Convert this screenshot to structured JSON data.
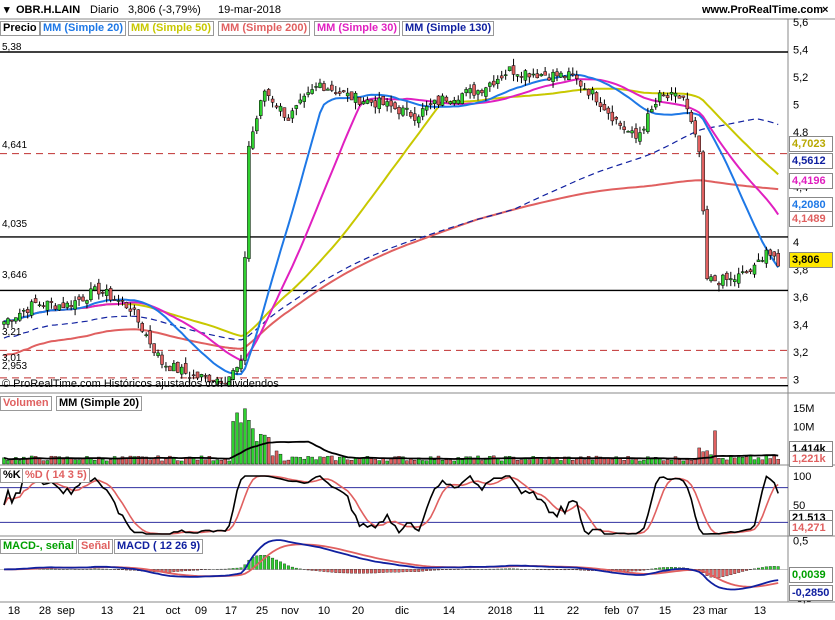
{
  "header": {
    "symbol": "OBR.H.LAIN",
    "period": "Diario",
    "quote": "3,806 (-3,79%)",
    "date": "19-mar-2018",
    "site": "www.ProRealTime.com"
  },
  "price_panel": {
    "label": "Precio",
    "legend": [
      {
        "label": "MM (Simple 20)",
        "color": "#1e78e6"
      },
      {
        "label": "MM (Simple 50)",
        "color": "#c8c800"
      },
      {
        "label": "MM (Simple 200)",
        "color": "#e06060"
      },
      {
        "label": "MM (Simple 30)",
        "color": "#e020c0"
      },
      {
        "label": "MM (Simple 130)",
        "color": "#1020a0"
      }
    ],
    "copyright": "© ProRealTime.com  Históricos ajustados con dividendos",
    "level_labels": [
      "5,38",
      "4,641",
      "4,035",
      "3,646",
      "3,21",
      "3,01",
      "2,953"
    ],
    "tags": [
      {
        "text": "4,7023",
        "color": "#b8a800"
      },
      {
        "text": "4,5612",
        "color": "#1020a0"
      },
      {
        "text": "4,4196",
        "color": "#e020c0"
      },
      {
        "text": "4,2080",
        "color": "#1e78e6"
      },
      {
        "text": "4,1489",
        "color": "#e06060"
      },
      {
        "text": "3,806",
        "color": "#000000"
      }
    ]
  },
  "volume_panel": {
    "label": "Volumen",
    "ma_label": "MM (Simple 20)",
    "tags": [
      {
        "text": "1,414k",
        "color": "#000000"
      },
      {
        "text": "1,221k",
        "color": "#e06060"
      }
    ]
  },
  "stoch_panel": {
    "label_k": "%K",
    "label_d": "%D ( 14 3 5)",
    "tags": [
      {
        "text": "21,513",
        "color": "#000000"
      },
      {
        "text": "14,271",
        "color": "#e06060"
      }
    ]
  },
  "macd_panel": {
    "label_macd": "MACD-, señal",
    "label_signal": "Señal",
    "label_params": "MACD ( 12 26 9)",
    "tags": [
      {
        "text": "0,0039",
        "color": "#00a000"
      },
      {
        "text": "-0,2850",
        "color": "#1020a0"
      }
    ]
  },
  "chart_data": {
    "type": "candlestick",
    "colors": {
      "up": "#30d030",
      "down": "#e06060"
    },
    "price_axis": {
      "min": 2.9,
      "max": 5.62,
      "ticks": [
        "5,6",
        "5,4",
        "5,2",
        "5",
        "4,8",
        "4,6",
        "4,4",
        "4,2",
        "4",
        "3,8",
        "3,6",
        "3,4",
        "3,2",
        "3"
      ],
      "tick_values": [
        5.6,
        5.4,
        5.2,
        5.0,
        4.8,
        4.6,
        4.4,
        4.2,
        4.0,
        3.8,
        3.6,
        3.4,
        3.2,
        3.0
      ]
    },
    "horizontal_levels": [
      {
        "value": 5.38,
        "style": "solid"
      },
      {
        "value": 4.641,
        "style": "dashed"
      },
      {
        "value": 4.035,
        "style": "solid"
      },
      {
        "value": 3.646,
        "style": "solid"
      },
      {
        "value": 3.21,
        "style": "dashed"
      },
      {
        "value": 3.01,
        "style": "dashed"
      },
      {
        "value": 2.953,
        "style": "solid"
      }
    ],
    "x_labels": [
      "18",
      "28",
      "sep",
      "13",
      "21",
      "oct",
      "09",
      "17",
      "25",
      "nov",
      "10",
      "20",
      "dic",
      "14",
      "2018",
      "11",
      "22",
      "feb",
      "07",
      "15",
      "23",
      "mar",
      "13"
    ],
    "close_anchors": [
      [
        0,
        3.42
      ],
      [
        8,
        3.55
      ],
      [
        16,
        3.54
      ],
      [
        24,
        3.65
      ],
      [
        32,
        3.52
      ],
      [
        40,
        3.12
      ],
      [
        48,
        3.02
      ],
      [
        56,
        3.0
      ],
      [
        60,
        3.1
      ],
      [
        62,
        4.7
      ],
      [
        66,
        5.1
      ],
      [
        72,
        4.9
      ],
      [
        80,
        5.15
      ],
      [
        88,
        5.05
      ],
      [
        96,
        5.0
      ],
      [
        104,
        4.92
      ],
      [
        112,
        5.05
      ],
      [
        120,
        5.1
      ],
      [
        128,
        5.25
      ],
      [
        136,
        5.22
      ],
      [
        144,
        5.2
      ],
      [
        150,
        5.05
      ],
      [
        156,
        4.85
      ],
      [
        160,
        4.75
      ],
      [
        166,
        5.05
      ],
      [
        172,
        5.05
      ],
      [
        174,
        4.85
      ],
      [
        176,
        4.65
      ],
      [
        178,
        3.72
      ],
      [
        184,
        3.72
      ],
      [
        190,
        3.8
      ],
      [
        193,
        3.95
      ],
      [
        196,
        3.81
      ]
    ],
    "volume_axis": {
      "ticks": [
        "15M",
        "10M",
        "5M"
      ],
      "tick_values": [
        15,
        10,
        5
      ],
      "max": 16
    },
    "stochastic_axis": {
      "ticks": [
        "100",
        "50"
      ],
      "tick_values": [
        100,
        50
      ]
    },
    "macd_axis": {
      "ticks": [
        "0,5",
        "0",
        "-0,5"
      ],
      "tick_values": [
        0.5,
        0,
        -0.5
      ],
      "min": -0.55,
      "max": 0.58
    }
  }
}
